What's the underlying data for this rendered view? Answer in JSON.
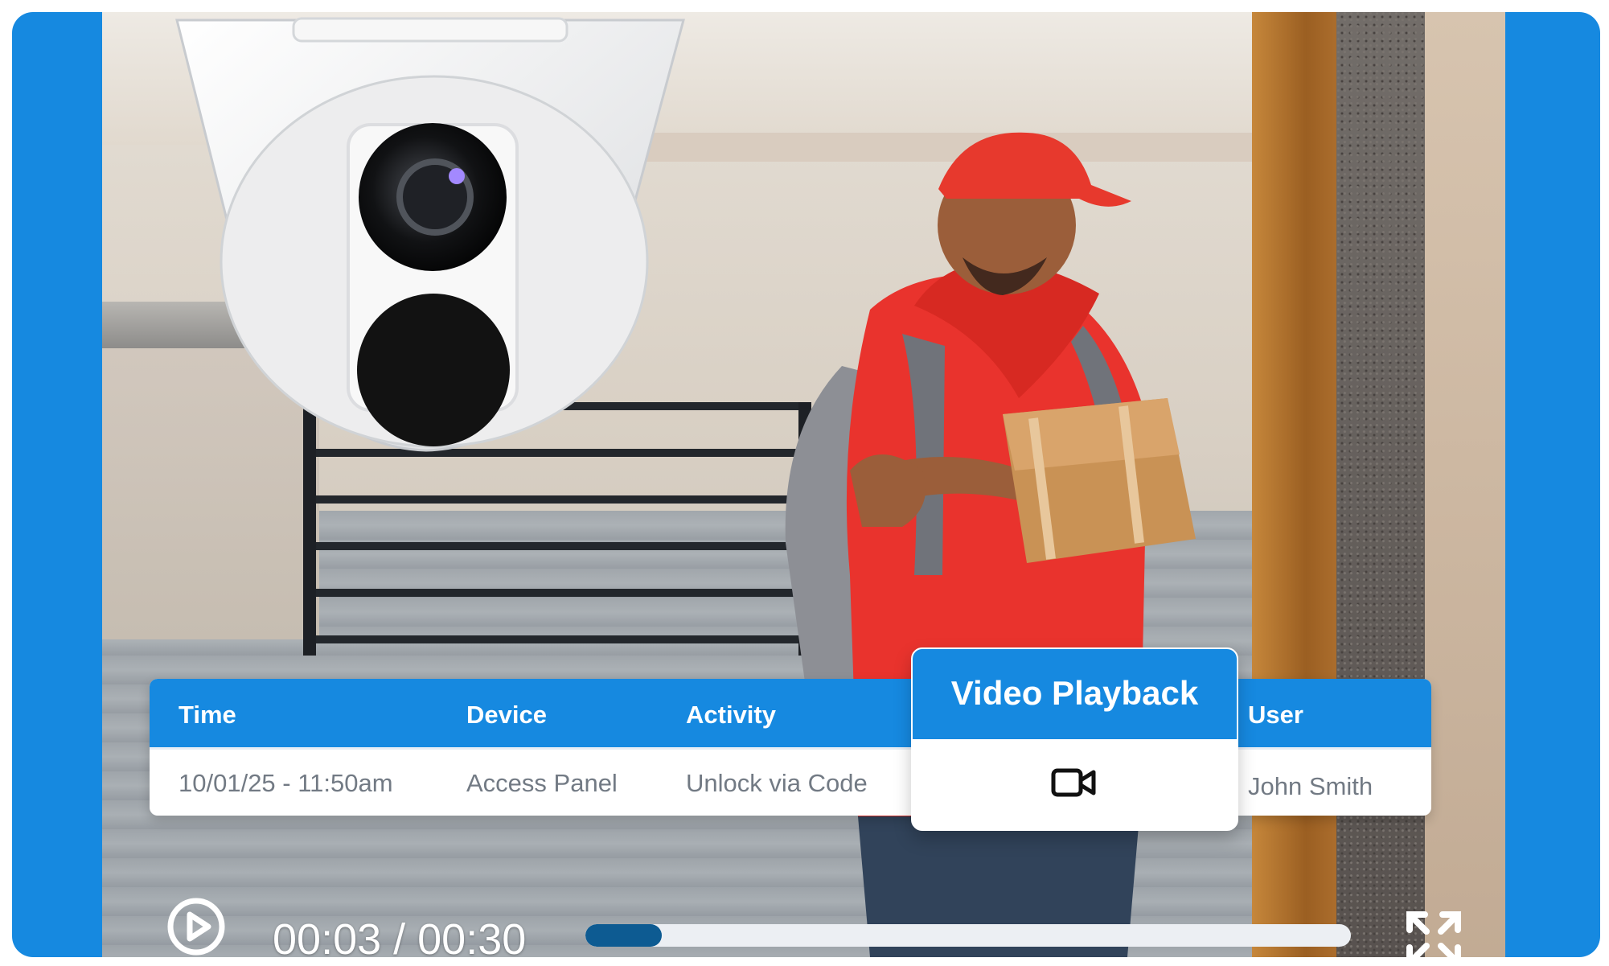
{
  "table": {
    "headers": {
      "time": "Time",
      "device": "Device",
      "activity": "Activity",
      "user": "User"
    },
    "row": {
      "time": "10/01/25 - 11:50am",
      "device": "Access Panel",
      "activity": "Unlock via Code",
      "user": "John Smith"
    }
  },
  "playback": {
    "title": "Video Playback",
    "icon": "video-camera-icon"
  },
  "player": {
    "time": "00:03 / 00:30",
    "progress": 0.1,
    "play_icon": "play-circle-icon",
    "fullscreen_icon": "fullscreen-icon"
  },
  "colors": {
    "accent_blue": "#1689e0",
    "progress_fill": "#0d5b92",
    "progress_track": "#eceff3",
    "text_muted": "#727a84"
  }
}
